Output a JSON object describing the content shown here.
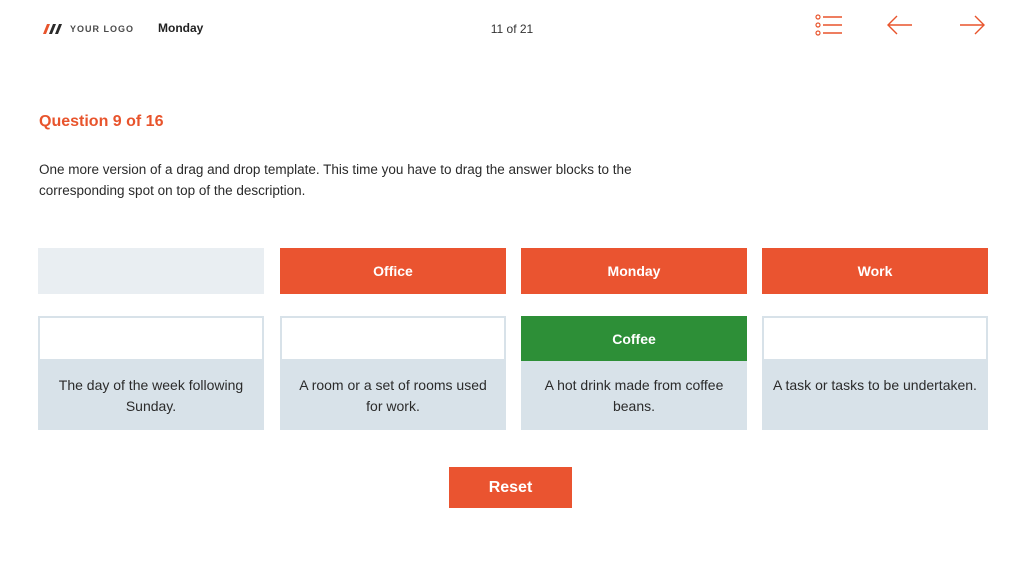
{
  "header": {
    "logo_text": "YOUR LOGO",
    "course_title": "Monday",
    "page_counter": "11 of 21",
    "icons": {
      "menu": "list-menu-icon",
      "prev": "arrow-left-icon",
      "next": "arrow-right-icon"
    }
  },
  "question": {
    "title": "Question 9 of 16",
    "instructions": "One more version of a drag and drop template. This time you have to drag the answer blocks to the corresponding spot on top of the description."
  },
  "answer_blocks": [
    {
      "label": "Office"
    },
    {
      "label": "Monday"
    },
    {
      "label": "Work"
    }
  ],
  "cards": [
    {
      "description": "The day of the week following Sunday.",
      "dropped": ""
    },
    {
      "description": "A room or a set of rooms used for work.",
      "dropped": ""
    },
    {
      "description": "A hot drink made from coffee beans.",
      "dropped": "Coffee"
    },
    {
      "description": "A task or tasks to be undertaken.",
      "dropped": ""
    }
  ],
  "buttons": {
    "reset": "Reset"
  },
  "colors": {
    "accent": "#ea5430",
    "correct": "#2d8f37",
    "card_bg": "#d8e2e9",
    "empty_slot": "#e9eef2"
  }
}
